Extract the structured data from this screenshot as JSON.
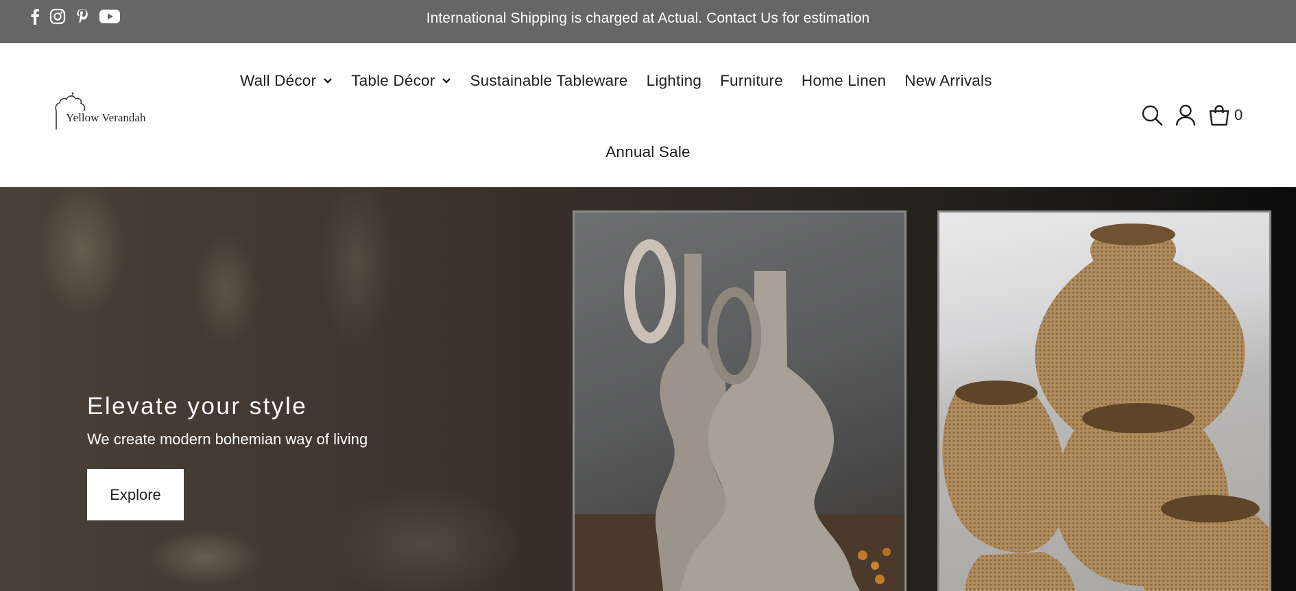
{
  "announcement": {
    "text": "International Shipping is charged at Actual. Contact Us for estimation",
    "social_icons": [
      "facebook-icon",
      "instagram-icon",
      "pinterest-icon",
      "youtube-icon"
    ]
  },
  "brand": {
    "logo_text": "Yellow Verandah"
  },
  "nav": {
    "items": [
      {
        "label": "Wall Décor",
        "has_dropdown": true
      },
      {
        "label": "Table Décor",
        "has_dropdown": true
      },
      {
        "label": "Sustainable Tableware",
        "has_dropdown": false
      },
      {
        "label": "Lighting",
        "has_dropdown": false
      },
      {
        "label": "Furniture",
        "has_dropdown": false
      },
      {
        "label": "Home Linen",
        "has_dropdown": false
      },
      {
        "label": "New Arrivals",
        "has_dropdown": false
      }
    ],
    "second_row": {
      "label": "Annual Sale"
    }
  },
  "header_icons": {
    "search": "search-icon",
    "account": "user-icon",
    "cart": "shopping-bag-icon",
    "cart_count": "0"
  },
  "hero": {
    "title": "Elevate your style",
    "subtitle": "We create modern bohemian way of living",
    "button_label": "Explore",
    "images": [
      "ceramic vases photo",
      "woven baskets photo"
    ]
  },
  "colors": {
    "announcement_bg": "#666666",
    "header_bg": "#ffffff",
    "hero_text": "#ffffff",
    "button_bg": "#ffffff"
  }
}
